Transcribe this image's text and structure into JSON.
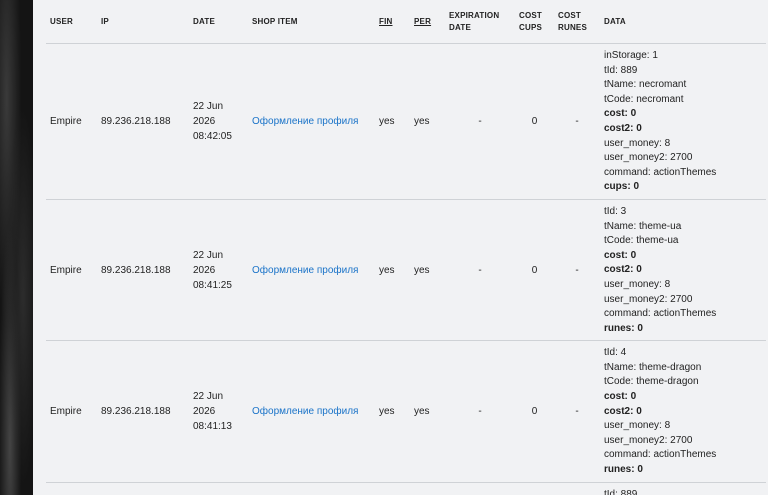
{
  "headers": {
    "user": "USER",
    "ip": "IP",
    "date": "DATE",
    "shop_item": "SHOP ITEM",
    "fin": "FIN",
    "per": "PER",
    "expiration_line1": "EXPIRATION",
    "expiration_line2": "DATE",
    "cost_cups_line1": "COST",
    "cost_cups_line2": "CUPS",
    "cost_runes_line1": "COST",
    "cost_runes_line2": "RUNES",
    "data": "DATA"
  },
  "rows": [
    {
      "user": "Empire",
      "ip": "89.236.218.188",
      "date_day": "22 Jun",
      "date_year": "2026",
      "date_time": "08:42:05",
      "shop_item": "Оформление профиля",
      "fin": "yes",
      "per": "yes",
      "expiration": "-",
      "cost_cups": "0",
      "cost_runes": "-",
      "data": [
        {
          "text": "inStorage: 1",
          "bold": false
        },
        {
          "text": "tId: 889",
          "bold": false
        },
        {
          "text": "tName: necromant",
          "bold": false
        },
        {
          "text": "tCode: necromant",
          "bold": false
        },
        {
          "text": "cost: 0",
          "bold": true
        },
        {
          "text": "cost2: 0",
          "bold": true
        },
        {
          "text": "user_money: 8",
          "bold": false
        },
        {
          "text": "user_money2: 2700",
          "bold": false
        },
        {
          "text": "command: actionThemes",
          "bold": false
        },
        {
          "text": "cups: 0",
          "bold": true
        }
      ]
    },
    {
      "user": "Empire",
      "ip": "89.236.218.188",
      "date_day": "22 Jun",
      "date_year": "2026",
      "date_time": "08:41:25",
      "shop_item": "Оформление профиля",
      "fin": "yes",
      "per": "yes",
      "expiration": "-",
      "cost_cups": "0",
      "cost_runes": "-",
      "data": [
        {
          "text": "tId: 3",
          "bold": false
        },
        {
          "text": "tName: theme-ua",
          "bold": false
        },
        {
          "text": "tCode: theme-ua",
          "bold": false
        },
        {
          "text": "cost: 0",
          "bold": true
        },
        {
          "text": "cost2: 0",
          "bold": true
        },
        {
          "text": "user_money: 8",
          "bold": false
        },
        {
          "text": "user_money2: 2700",
          "bold": false
        },
        {
          "text": "command: actionThemes",
          "bold": false
        },
        {
          "text": "runes: 0",
          "bold": true
        }
      ]
    },
    {
      "user": "Empire",
      "ip": "89.236.218.188",
      "date_day": "22 Jun",
      "date_year": "2026",
      "date_time": "08:41:13",
      "shop_item": "Оформление профиля",
      "fin": "yes",
      "per": "yes",
      "expiration": "-",
      "cost_cups": "0",
      "cost_runes": "-",
      "data": [
        {
          "text": "tId: 4",
          "bold": false
        },
        {
          "text": "tName: theme-dragon",
          "bold": false
        },
        {
          "text": "tCode: theme-dragon",
          "bold": false
        },
        {
          "text": "cost: 0",
          "bold": true
        },
        {
          "text": "cost2: 0",
          "bold": true
        },
        {
          "text": "user_money: 8",
          "bold": false
        },
        {
          "text": "user_money2: 2700",
          "bold": false
        },
        {
          "text": "command: actionThemes",
          "bold": false
        },
        {
          "text": "runes: 0",
          "bold": true
        }
      ]
    },
    {
      "user": "",
      "ip": "",
      "date_day": "",
      "date_year": "",
      "date_time": "",
      "shop_item": "",
      "fin": "",
      "per": "",
      "expiration": "",
      "cost_cups": "",
      "cost_runes": "",
      "data": [
        {
          "text": "tId: 889",
          "bold": false
        }
      ]
    }
  ],
  "colors": {
    "link": "#1a73c8",
    "panel_bg": "#f1f2f4",
    "divider": "#cfd2d6"
  }
}
